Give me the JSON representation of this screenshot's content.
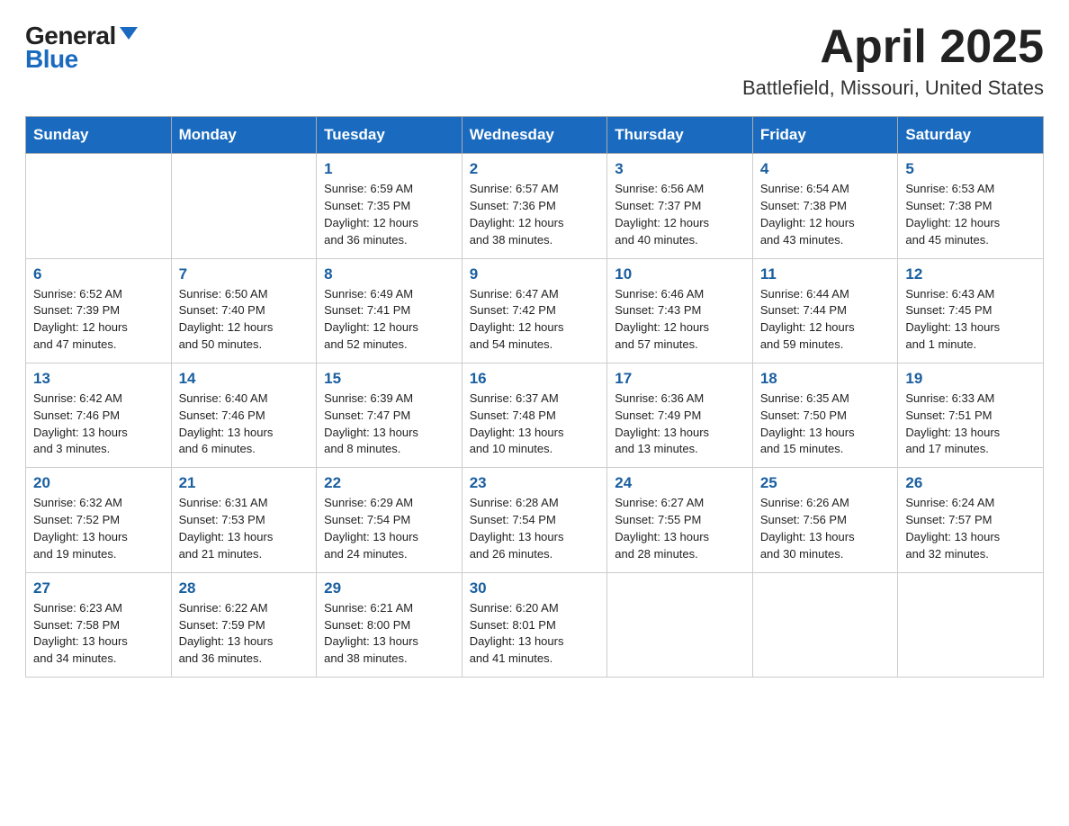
{
  "header": {
    "logo_general": "General",
    "logo_blue": "Blue",
    "title": "April 2025",
    "subtitle": "Battlefield, Missouri, United States"
  },
  "days_of_week": [
    "Sunday",
    "Monday",
    "Tuesday",
    "Wednesday",
    "Thursday",
    "Friday",
    "Saturday"
  ],
  "weeks": [
    [
      {
        "day": "",
        "info": ""
      },
      {
        "day": "",
        "info": ""
      },
      {
        "day": "1",
        "info": "Sunrise: 6:59 AM\nSunset: 7:35 PM\nDaylight: 12 hours\nand 36 minutes."
      },
      {
        "day": "2",
        "info": "Sunrise: 6:57 AM\nSunset: 7:36 PM\nDaylight: 12 hours\nand 38 minutes."
      },
      {
        "day": "3",
        "info": "Sunrise: 6:56 AM\nSunset: 7:37 PM\nDaylight: 12 hours\nand 40 minutes."
      },
      {
        "day": "4",
        "info": "Sunrise: 6:54 AM\nSunset: 7:38 PM\nDaylight: 12 hours\nand 43 minutes."
      },
      {
        "day": "5",
        "info": "Sunrise: 6:53 AM\nSunset: 7:38 PM\nDaylight: 12 hours\nand 45 minutes."
      }
    ],
    [
      {
        "day": "6",
        "info": "Sunrise: 6:52 AM\nSunset: 7:39 PM\nDaylight: 12 hours\nand 47 minutes."
      },
      {
        "day": "7",
        "info": "Sunrise: 6:50 AM\nSunset: 7:40 PM\nDaylight: 12 hours\nand 50 minutes."
      },
      {
        "day": "8",
        "info": "Sunrise: 6:49 AM\nSunset: 7:41 PM\nDaylight: 12 hours\nand 52 minutes."
      },
      {
        "day": "9",
        "info": "Sunrise: 6:47 AM\nSunset: 7:42 PM\nDaylight: 12 hours\nand 54 minutes."
      },
      {
        "day": "10",
        "info": "Sunrise: 6:46 AM\nSunset: 7:43 PM\nDaylight: 12 hours\nand 57 minutes."
      },
      {
        "day": "11",
        "info": "Sunrise: 6:44 AM\nSunset: 7:44 PM\nDaylight: 12 hours\nand 59 minutes."
      },
      {
        "day": "12",
        "info": "Sunrise: 6:43 AM\nSunset: 7:45 PM\nDaylight: 13 hours\nand 1 minute."
      }
    ],
    [
      {
        "day": "13",
        "info": "Sunrise: 6:42 AM\nSunset: 7:46 PM\nDaylight: 13 hours\nand 3 minutes."
      },
      {
        "day": "14",
        "info": "Sunrise: 6:40 AM\nSunset: 7:46 PM\nDaylight: 13 hours\nand 6 minutes."
      },
      {
        "day": "15",
        "info": "Sunrise: 6:39 AM\nSunset: 7:47 PM\nDaylight: 13 hours\nand 8 minutes."
      },
      {
        "day": "16",
        "info": "Sunrise: 6:37 AM\nSunset: 7:48 PM\nDaylight: 13 hours\nand 10 minutes."
      },
      {
        "day": "17",
        "info": "Sunrise: 6:36 AM\nSunset: 7:49 PM\nDaylight: 13 hours\nand 13 minutes."
      },
      {
        "day": "18",
        "info": "Sunrise: 6:35 AM\nSunset: 7:50 PM\nDaylight: 13 hours\nand 15 minutes."
      },
      {
        "day": "19",
        "info": "Sunrise: 6:33 AM\nSunset: 7:51 PM\nDaylight: 13 hours\nand 17 minutes."
      }
    ],
    [
      {
        "day": "20",
        "info": "Sunrise: 6:32 AM\nSunset: 7:52 PM\nDaylight: 13 hours\nand 19 minutes."
      },
      {
        "day": "21",
        "info": "Sunrise: 6:31 AM\nSunset: 7:53 PM\nDaylight: 13 hours\nand 21 minutes."
      },
      {
        "day": "22",
        "info": "Sunrise: 6:29 AM\nSunset: 7:54 PM\nDaylight: 13 hours\nand 24 minutes."
      },
      {
        "day": "23",
        "info": "Sunrise: 6:28 AM\nSunset: 7:54 PM\nDaylight: 13 hours\nand 26 minutes."
      },
      {
        "day": "24",
        "info": "Sunrise: 6:27 AM\nSunset: 7:55 PM\nDaylight: 13 hours\nand 28 minutes."
      },
      {
        "day": "25",
        "info": "Sunrise: 6:26 AM\nSunset: 7:56 PM\nDaylight: 13 hours\nand 30 minutes."
      },
      {
        "day": "26",
        "info": "Sunrise: 6:24 AM\nSunset: 7:57 PM\nDaylight: 13 hours\nand 32 minutes."
      }
    ],
    [
      {
        "day": "27",
        "info": "Sunrise: 6:23 AM\nSunset: 7:58 PM\nDaylight: 13 hours\nand 34 minutes."
      },
      {
        "day": "28",
        "info": "Sunrise: 6:22 AM\nSunset: 7:59 PM\nDaylight: 13 hours\nand 36 minutes."
      },
      {
        "day": "29",
        "info": "Sunrise: 6:21 AM\nSunset: 8:00 PM\nDaylight: 13 hours\nand 38 minutes."
      },
      {
        "day": "30",
        "info": "Sunrise: 6:20 AM\nSunset: 8:01 PM\nDaylight: 13 hours\nand 41 minutes."
      },
      {
        "day": "",
        "info": ""
      },
      {
        "day": "",
        "info": ""
      },
      {
        "day": "",
        "info": ""
      }
    ]
  ]
}
